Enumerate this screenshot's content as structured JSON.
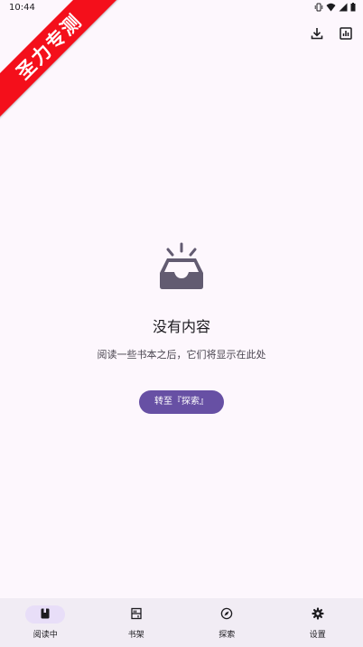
{
  "status_bar": {
    "time": "10:44",
    "icons": [
      "vibrate-icon",
      "wifi-icon",
      "signal-icon",
      "battery-icon"
    ]
  },
  "watermark": {
    "text": "圣力专测",
    "color": "#f40f1b"
  },
  "top_actions": [
    {
      "name": "download-icon"
    },
    {
      "name": "chart-icon"
    }
  ],
  "empty_state": {
    "icon": "empty-inbox-icon",
    "title": "没有内容",
    "description": "阅读一些书本之后，它们将显示在此处",
    "button_label": "转至『探索』"
  },
  "bottom_nav": {
    "items": [
      {
        "label": "阅读中",
        "icon": "book-icon",
        "active": true
      },
      {
        "label": "书架",
        "icon": "shelf-icon",
        "active": false
      },
      {
        "label": "探索",
        "icon": "compass-icon",
        "active": false
      },
      {
        "label": "设置",
        "icon": "gear-icon",
        "active": false
      }
    ]
  },
  "colors": {
    "background": "#fdf7fd",
    "accent": "#6750a4",
    "nav_background": "#f1ecf4",
    "active_pill": "#e8def8",
    "illustration": "#625b71"
  }
}
